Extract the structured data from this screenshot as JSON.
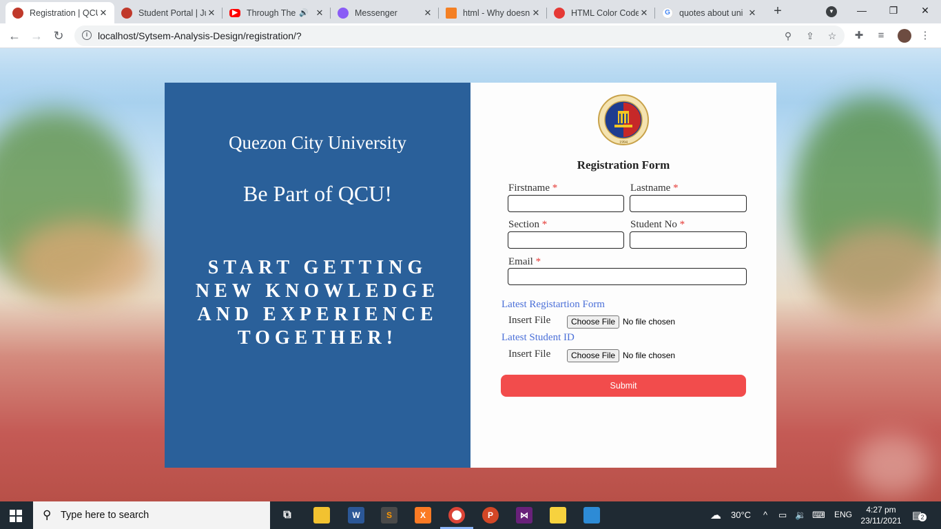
{
  "browser": {
    "tabs": [
      {
        "title": "Registration | QCU",
        "active": true,
        "favicon_color": "#c0392b"
      },
      {
        "title": "Student Portal | Ju",
        "favicon_color": "#c0392b"
      },
      {
        "title": "Through The",
        "favicon_color": "#ff0000",
        "audio": true
      },
      {
        "title": "Messenger",
        "favicon_color": "#8a5cf6"
      },
      {
        "title": "html - Why doesn",
        "favicon_color": "#f48024"
      },
      {
        "title": "HTML Color Code",
        "favicon_color": "#e53935"
      },
      {
        "title": "quotes about uni",
        "favicon_color": "#4285f4"
      }
    ],
    "close_glyph": "✕",
    "new_tab_glyph": "+",
    "url": "localhost/Sytsem-Analysis-Design/registration/?"
  },
  "left_panel": {
    "university": "Quezon City University",
    "slogan": "Be Part of QCU!",
    "tagline": "START GETTING NEW KNOWLEDGE AND EXPERIENCE TOGETHER!"
  },
  "form": {
    "title": "Registration Form",
    "seal_text": "QUEZON CITY UNIVERSITY",
    "seal_year": "1994",
    "required_mark": "*",
    "fields": {
      "firstname": "Firstname",
      "lastname": "Lastname",
      "section": "Section",
      "student_no": "Student No",
      "email": "Email"
    },
    "uploads": {
      "reg_form_label": "Latest Registartion Form",
      "student_id_label": "Latest Student ID",
      "insert_label": "Insert File",
      "choose_label": "Choose File",
      "no_file": "No file chosen"
    },
    "submit_label": "Submit"
  },
  "taskbar": {
    "search_placeholder": "Type here to search",
    "weather": "30°C",
    "language": "ENG",
    "time": "4:27 pm",
    "date": "23/11/2021",
    "notifications": "2"
  },
  "colors": {
    "left_panel_bg": "#2a609a",
    "submit_bg": "#f24c4c",
    "link_blue": "#4a6fd8",
    "required_red": "#e53935"
  }
}
